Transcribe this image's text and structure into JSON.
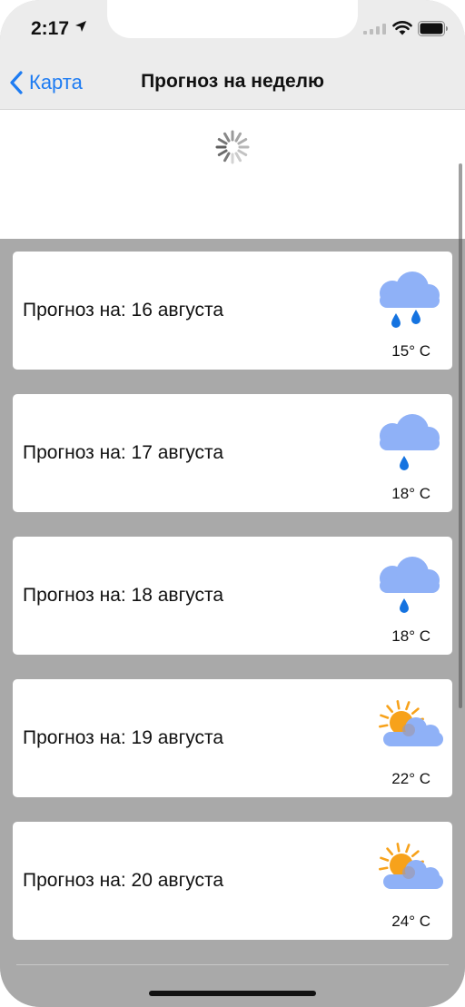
{
  "status_bar": {
    "time": "2:17",
    "icons": [
      "location-arrow-icon",
      "cellular-signal-icon",
      "wifi-icon",
      "battery-icon"
    ]
  },
  "nav": {
    "back_label": "Карта",
    "title": "Прогноз на неделю"
  },
  "loading": {
    "icon": "activity-spinner-icon"
  },
  "colors": {
    "accent": "#1e7cf2",
    "list_background": "#a9a9a9",
    "cloud": "#8fb1f7",
    "rain": "#1573e0",
    "sun": "#f7a21b"
  },
  "forecast": [
    {
      "label": "Прогноз на: 16 августа",
      "temp": "15° C",
      "icon": "cloud-heavy-rain-icon"
    },
    {
      "label": "Прогноз на: 17 августа",
      "temp": "18° C",
      "icon": "cloud-light-rain-icon"
    },
    {
      "label": "Прогноз на: 18 августа",
      "temp": "18° C",
      "icon": "cloud-light-rain-icon"
    },
    {
      "label": "Прогноз на: 19 августа",
      "temp": "22° C",
      "icon": "sun-behind-cloud-icon"
    },
    {
      "label": "Прогноз на: 20 августа",
      "temp": "24° C",
      "icon": "sun-behind-cloud-icon"
    }
  ]
}
